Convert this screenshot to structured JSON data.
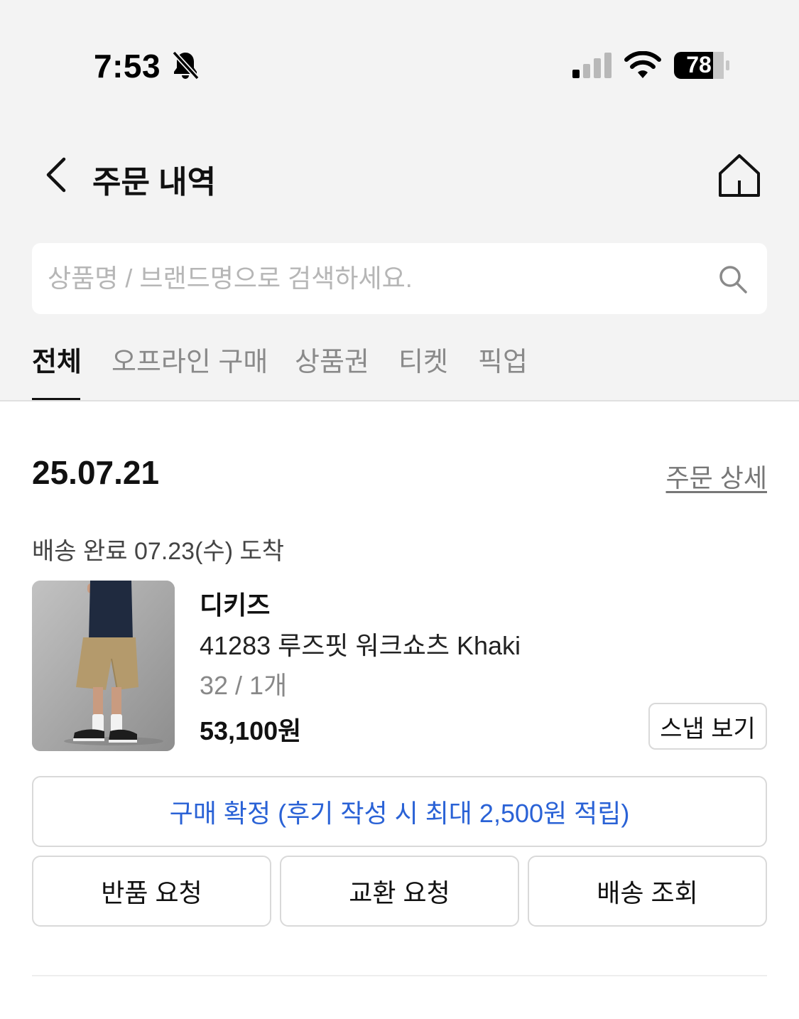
{
  "status_bar": {
    "time": "7:53",
    "battery": "78",
    "icons": [
      "bell-muted-icon",
      "cellular-signal-icon",
      "wifi-icon",
      "battery-icon"
    ]
  },
  "header": {
    "title": "주문 내역",
    "back_icon": "chevron-left-icon",
    "home_icon": "home-icon"
  },
  "search": {
    "placeholder": "상품명 / 브랜드명으로 검색하세요.",
    "value": "",
    "icon": "search-icon"
  },
  "tabs": [
    {
      "label": "전체",
      "active": true
    },
    {
      "label": "오프라인 구매",
      "active": false
    },
    {
      "label": "상품권",
      "active": false
    },
    {
      "label": "티켓",
      "active": false
    },
    {
      "label": "픽업",
      "active": false
    }
  ],
  "order": {
    "date": "25.07.21",
    "detail_link": "주문 상세",
    "delivery_status": "배송 완료 07.23(수) 도착",
    "item": {
      "brand": "디키즈",
      "name": "41283 루즈핏 워크쇼츠 Khaki",
      "option": "32 / 1개",
      "price": "53,100원",
      "snap_button": "스냅 보기"
    },
    "confirm_button": "구매 확정 (후기 작성 시 최대 2,500원 적립)",
    "actions": [
      "반품 요청",
      "교환 요청",
      "배송 조회"
    ]
  },
  "colors": {
    "accent_blue": "#2a62d6",
    "top_background": "#f3f3f3",
    "border": "#d9d9d9"
  }
}
